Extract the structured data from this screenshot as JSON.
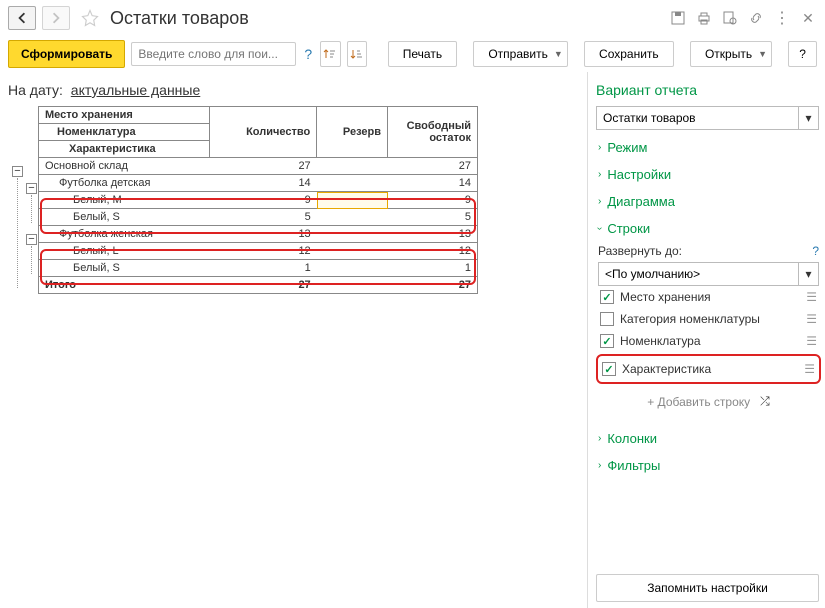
{
  "header": {
    "title": "Остатки товаров"
  },
  "toolbar": {
    "form_button": "Сформировать",
    "search_placeholder": "Введите слово для пои...",
    "print": "Печать",
    "send": "Отправить",
    "save": "Сохранить",
    "open": "Открыть",
    "help": "?"
  },
  "date_line": {
    "label": "На дату:",
    "value": "актуальные данные"
  },
  "report": {
    "headers": {
      "location": "Место хранения",
      "nomenclature": "Номенклатура",
      "characteristic": "Характеристика",
      "qty": "Количество",
      "reserve": "Резерв",
      "free": "Свободный остаток"
    },
    "rows": [
      {
        "level": 1,
        "name": "Основной склад",
        "qty": "27",
        "reserve": "",
        "free": "27"
      },
      {
        "level": 2,
        "name": "Футболка детская",
        "qty": "14",
        "reserve": "",
        "free": "14"
      },
      {
        "level": 3,
        "name": "Белый, M",
        "qty": "9",
        "reserve": "",
        "free": "9"
      },
      {
        "level": 3,
        "name": "Белый, S",
        "qty": "5",
        "reserve": "",
        "free": "5"
      },
      {
        "level": 2,
        "name": "Футболка женская",
        "qty": "13",
        "reserve": "",
        "free": "13"
      },
      {
        "level": 3,
        "name": "Белый, L",
        "qty": "12",
        "reserve": "",
        "free": "12"
      },
      {
        "level": 3,
        "name": "Белый, S",
        "qty": "1",
        "reserve": "",
        "free": "1"
      }
    ],
    "total": {
      "label": "Итого",
      "qty": "27",
      "reserve": "",
      "free": "27"
    }
  },
  "right": {
    "variant_title": "Вариант отчета",
    "variant_value": "Остатки товаров",
    "sections": {
      "mode": "Режим",
      "settings": "Настройки",
      "diagram": "Диаграмма",
      "rows": "Строки",
      "columns": "Колонки",
      "filters": "Фильтры"
    },
    "rows_panel": {
      "expand_label": "Развернуть до:",
      "default_value": "<По умолчанию>",
      "items": [
        {
          "checked": true,
          "label": "Место хранения"
        },
        {
          "checked": false,
          "label": "Категория номенклатуры"
        },
        {
          "checked": true,
          "label": "Номенклатура"
        },
        {
          "checked": true,
          "label": "Характеристика"
        }
      ],
      "add_row": "+ Добавить строку"
    },
    "footer_button": "Запомнить настройки"
  }
}
